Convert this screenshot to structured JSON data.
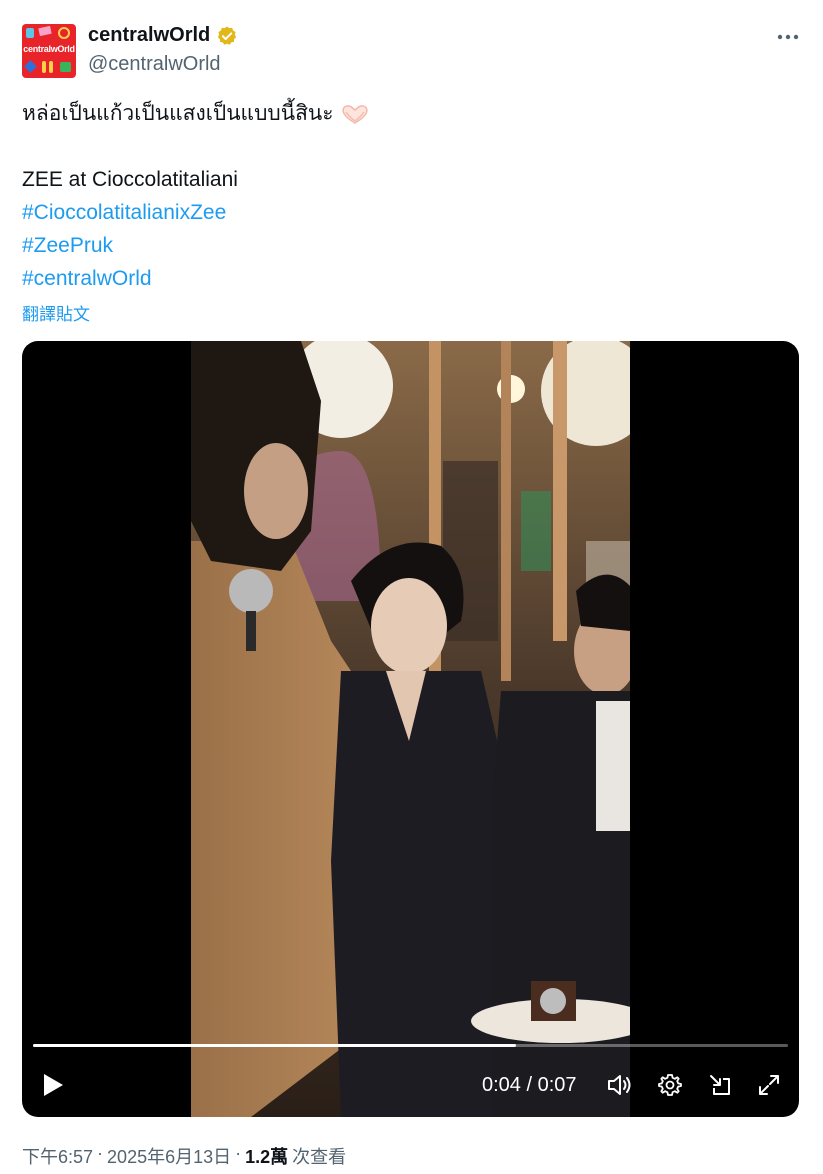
{
  "author": {
    "display_name": "centralwOrld",
    "handle": "@centralwOrld",
    "avatar_text": "centralwOrld",
    "verified": true,
    "verified_color": "#e2b719"
  },
  "tweet": {
    "line1": "หล่อเป็นแก้วเป็นแสงเป็นแบบนี้สินะ",
    "line1_emoji_icon": "heart-hands-icon",
    "line2": "ZEE at Cioccolatitaliani",
    "hashtags": [
      "#CioccolatitalianixZee",
      "#ZeePruk",
      "#centralwOrld"
    ],
    "translate_label": "翻譯貼文"
  },
  "video": {
    "progress": 0.64,
    "time_display": "0:04 / 0:07",
    "controls": [
      "play-icon",
      "volume-icon",
      "settings-icon",
      "popout-icon",
      "fullscreen-icon"
    ]
  },
  "meta": {
    "time": "下午6:57",
    "separator": "·",
    "date": "2025年6月13日",
    "views_count": "1.2萬",
    "views_label": "次查看"
  },
  "colors": {
    "link": "#1d9bf0",
    "secondary": "#536471",
    "brand": "#e8232a"
  }
}
